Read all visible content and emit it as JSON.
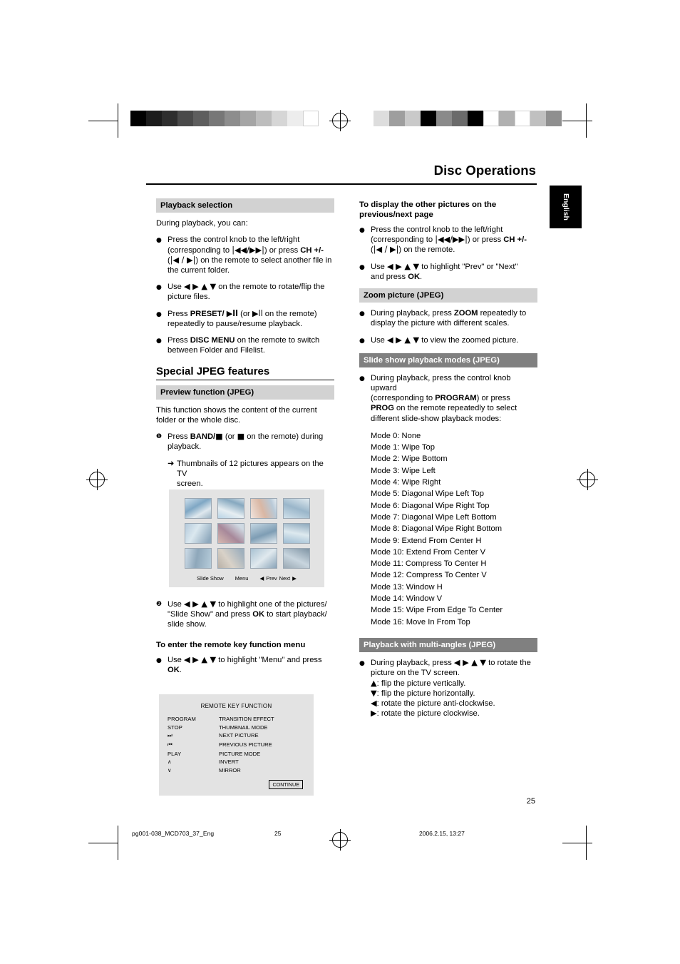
{
  "header": {
    "title": "Disc Operations",
    "side_tab": "English"
  },
  "left_column": {
    "playback_selection": {
      "heading": "Playback selection",
      "intro": "During playback, you can:",
      "items": [
        "Press the control knob to the left/right (corresponding to |◀◀/▶▶|) or press CH +/- (|◀ / ▶|) on the remote to select another file in the current folder.",
        "Use ◀ ▶ ▲ ▼ on the remote to rotate/flip the picture files.",
        "Press PRESET/ ▶ll (or ▶ll on the remote) repeatedly to pause/resume playback.",
        "Press DISC MENU on the remote to switch between Folder and Filelist."
      ]
    },
    "special_jpeg": {
      "heading": "Special JPEG features",
      "preview_heading": "Preview function (JPEG)",
      "preview_intro": "This function shows the content of the current folder or the whole disc.",
      "step1": "Press BAND/■ (or ■ on the remote) during playback.",
      "step1_arrow": "Thumbnails of 12 pictures appears on the TV screen.",
      "step2": "Use ◀ ▶ ▲ ▼ to highlight one of the pictures/ \"Slide Show\" and press OK to start playback/ slide show.",
      "remote_menu_heading": "To enter the remote key function menu",
      "remote_menu_item": "Use ◀ ▶ ▲ ▼ to highlight \"Menu\" and press OK."
    },
    "tv_figure": {
      "slide_show": "Slide Show",
      "menu": "Menu",
      "prev": "Prev",
      "next": "Next"
    },
    "remote_key_figure": {
      "title": "REMOTE KEY FUNCTION",
      "rows": [
        {
          "key": "PROGRAM",
          "action": "TRANSITION EFFECT"
        },
        {
          "key": "STOP",
          "action": "THUMBNAIL MODE"
        },
        {
          "key": "⏭",
          "action": "NEXT PICTURE"
        },
        {
          "key": "⏮",
          "action": "PREVIOUS PICTURE"
        },
        {
          "key": "PLAY",
          "action": "PICTURE MODE"
        },
        {
          "key": "∧",
          "action": "INVERT"
        },
        {
          "key": "∨",
          "action": "MIRROR"
        }
      ],
      "continue": "CONTINUE"
    }
  },
  "right_column": {
    "other_pictures": {
      "heading": "To display the other pictures on the previous/next page",
      "items": [
        "Press the control knob to the left/right (corresponding to |◀◀/▶▶|) or press CH +/- (|◀ / ▶|) on the remote.",
        "Use ◀ ▶ ▲ ▼ to highlight \"Prev\" or \"Next\" and press OK."
      ]
    },
    "zoom_picture": {
      "heading": "Zoom picture (JPEG)",
      "items": [
        "During playback, press ZOOM repeatedly to display the picture with different scales.",
        "Use ◀ ▶ ▲ ▼ to view the zoomed picture."
      ]
    },
    "slide_show_modes": {
      "heading": "Slide show playback modes (JPEG)",
      "intro": "During playback, press the control knob upward (corresponding to PROGRAM) or press PROG on the remote repeatedly to select different slide-show playback modes:",
      "modes": [
        "Mode 0: None",
        "Mode 1: Wipe Top",
        "Mode 2: Wipe Bottom",
        "Mode 3: Wipe Left",
        "Mode 4: Wipe Right",
        "Mode 5: Diagonal Wipe Left Top",
        "Mode 6: Diagonal Wipe Right Top",
        "Mode 7: Diagonal Wipe Left Bottom",
        "Mode 8: Diagonal Wipe Right Bottom",
        "Mode 9: Extend From Center H",
        "Mode 10: Extend From Center V",
        "Mode 11: Compress To Center H",
        "Mode 12: Compress To Center V",
        "Mode 13: Window H",
        "Mode 14: Window V",
        "Mode 15: Wipe From Edge To Center",
        "Mode 16: Move In From Top"
      ]
    },
    "multi_angles": {
      "heading": "Playback with multi-angles (JPEG)",
      "intro": "During playback, press ◀ ▶ ▲ ▼ to rotate the picture on the TV screen.",
      "lines": [
        "▲: flip the picture vertically.",
        "▼:  flip the picture horizontally.",
        "◀: rotate the picture anti-clockwise.",
        "▶: rotate the picture clockwise."
      ]
    }
  },
  "footer": {
    "page_number": "25",
    "file": "pg001-038_MCD703_37_Eng",
    "mid_page": "25",
    "timestamp": "2006.2.15, 13:27"
  }
}
